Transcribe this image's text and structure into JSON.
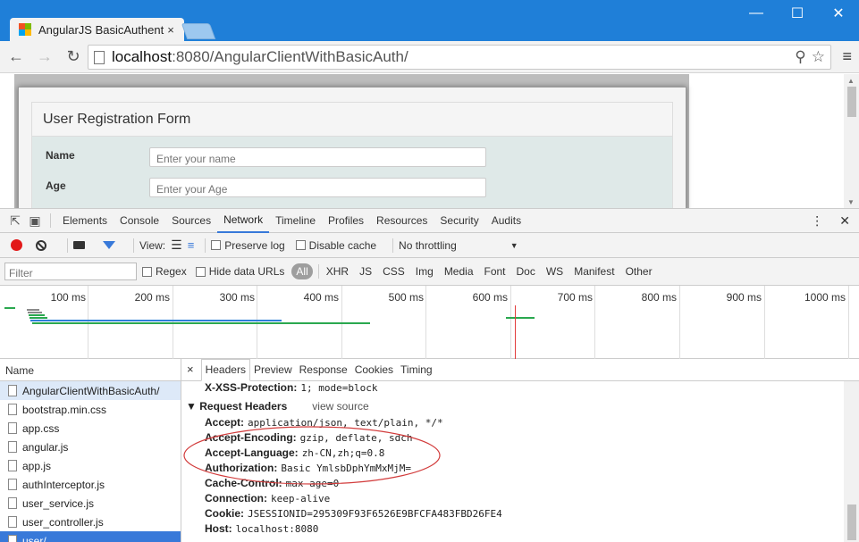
{
  "browser": {
    "tab_title": "AngularJS BasicAuthenti",
    "tab_close": "×",
    "window_buttons": {
      "minimize": "—",
      "maximize": "☐",
      "close": "✕"
    },
    "url_host": "localhost",
    "url_rest": ":8080/AngularClientWithBasicAuth/",
    "icons": {
      "back": "arrow-left-icon",
      "forward": "arrow-right-icon",
      "reload": "reload-icon",
      "zoom": "magnifier-icon",
      "star": "star-icon",
      "menu": "menu-icon"
    }
  },
  "page": {
    "form_title": "User Registration Form",
    "fields": [
      {
        "label": "Name",
        "placeholder": "Enter your name"
      },
      {
        "label": "Age",
        "placeholder": "Enter your Age"
      }
    ]
  },
  "devtools": {
    "tabs": [
      "Elements",
      "Console",
      "Sources",
      "Network",
      "Timeline",
      "Profiles",
      "Resources",
      "Security",
      "Audits"
    ],
    "active_tab": "Network",
    "toolbar": {
      "view_label": "View:",
      "preserve_log": "Preserve log",
      "disable_cache": "Disable cache",
      "throttling": "No throttling"
    },
    "filter": {
      "placeholder": "Filter",
      "regex": "Regex",
      "hide_data_urls": "Hide data URLs",
      "all": "All",
      "types": [
        "XHR",
        "JS",
        "CSS",
        "Img",
        "Media",
        "Font",
        "Doc",
        "WS",
        "Manifest",
        "Other"
      ]
    },
    "timeline_ticks": [
      "100 ms",
      "200 ms",
      "300 ms",
      "400 ms",
      "500 ms",
      "600 ms",
      "700 ms",
      "800 ms",
      "900 ms",
      "1000 ms"
    ],
    "requests_header": "Name",
    "requests": [
      "AngularClientWithBasicAuth/",
      "bootstrap.min.css",
      "app.css",
      "angular.js",
      "app.js",
      "authInterceptor.js",
      "user_service.js",
      "user_controller.js",
      "user/"
    ],
    "detail_tabs": [
      "Headers",
      "Preview",
      "Response",
      "Cookies",
      "Timing"
    ],
    "detail_close": "×",
    "prev_header": {
      "key": "X-XSS-Protection:",
      "value": "1; mode=block"
    },
    "section_title": "Request Headers",
    "view_source": "view source",
    "headers": [
      {
        "key": "Accept:",
        "value": "application/json, text/plain, */*"
      },
      {
        "key": "Accept-Encoding:",
        "value": "gzip, deflate, sdch"
      },
      {
        "key": "Accept-Language:",
        "value": "zh-CN,zh;q=0.8"
      },
      {
        "key": "Authorization:",
        "value": "Basic YmlsbDphYmMxMjM="
      },
      {
        "key": "Cache-Control:",
        "value": "max-age=0"
      },
      {
        "key": "Connection:",
        "value": "keep-alive"
      },
      {
        "key": "Cookie:",
        "value": "JSESSIONID=295309F93F6526E9BFCFA483FBD26FE4"
      },
      {
        "key": "Host:",
        "value": "localhost:8080"
      }
    ],
    "colors": {
      "accent": "#3879d9",
      "record": "#e21919",
      "annotation": "#d23c3c"
    }
  }
}
